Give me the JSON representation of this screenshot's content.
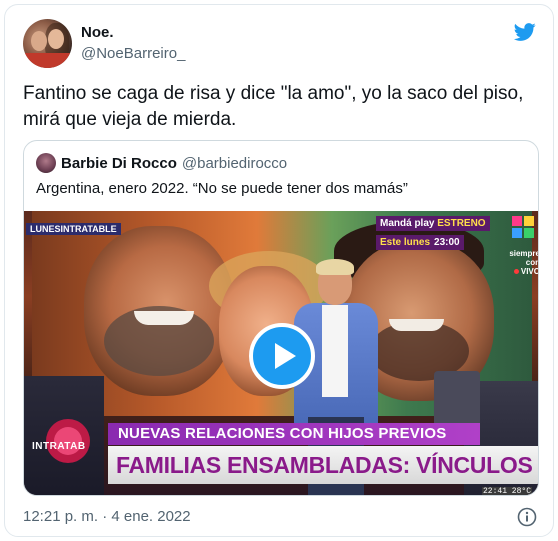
{
  "author": {
    "display_name": "Noe.",
    "handle": "@NoeBarreiro_"
  },
  "tweet": {
    "text": "Fantino se caga de risa y dice \"la amo\", yo la saco del piso, mirá que vieja de mierda."
  },
  "quoted": {
    "display_name": "Barbie Di Rocco",
    "handle": "@barbiedirocco",
    "text": "Argentina, enero 2022. “No se puede tener dos mamás”",
    "video": {
      "corner_tag": "LUNESINTRATABLE",
      "promo_line1_a": "Mandá play",
      "promo_line1_b": "ESTRENO",
      "promo_line2_a": "Este lunes",
      "promo_line2_b": "23:00",
      "live_label_1": "siempre con",
      "live_label_2": "VIVO",
      "show_logo": "INTRATAB",
      "lower_third_1": "NUEVAS RELACIONES CON HIJOS PREVIOS",
      "lower_third_2": "FAMILIAS ENSAMBLADAS: VÍNCULOS Y CONFLICTOS",
      "clock": "22:41 28°C"
    }
  },
  "meta": {
    "timestamp": "12:21 p. m. · 4 ene. 2022"
  },
  "icons": {
    "brand": "twitter-bird-icon",
    "play": "play-icon",
    "info": "info-icon"
  },
  "colors": {
    "twitter_blue": "#1d9bf0",
    "text_primary": "#0f1419",
    "text_secondary": "#536471",
    "border": "#cfd9de"
  }
}
